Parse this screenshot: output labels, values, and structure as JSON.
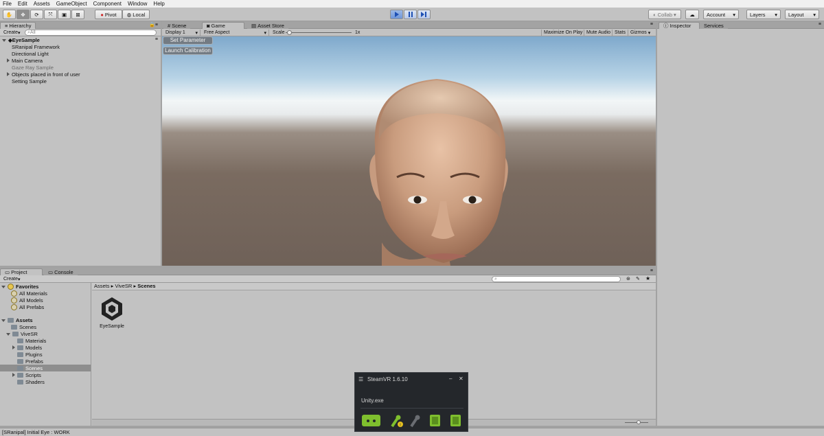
{
  "menubar": [
    "File",
    "Edit",
    "Assets",
    "GameObject",
    "Component",
    "Window",
    "Help"
  ],
  "toolbar": {
    "pivot": "Pivot",
    "local": "Local",
    "collab": "Collab",
    "account": "Account",
    "layers": "Layers",
    "layout": "Layout"
  },
  "hierarchy": {
    "tab": "Hierarchy",
    "create": "Create",
    "search_placeholder": "All",
    "scene": "EyeSample",
    "items": [
      "SRanipal Framework",
      "Directional Light",
      "Main Camera",
      "Gaze Ray Sample",
      "Objects placed in front of user",
      "Setting Sample"
    ]
  },
  "center_tabs": [
    "Scene",
    "Game",
    "Asset Store"
  ],
  "game_bar": {
    "display": "Display 1",
    "aspect": "Free Aspect",
    "scale_label": "Scale",
    "scale_value": "1x",
    "maximize": "Maximize On Play",
    "mute": "Mute Audio",
    "stats": "Stats",
    "gizmos": "Gizmos"
  },
  "game_buttons": {
    "set_parameter": "Set Parameter",
    "launch_calibration": "Launch Calibration"
  },
  "inspector_tabs": [
    "Inspector",
    "Services"
  ],
  "project": {
    "tabs": [
      "Project",
      "Console"
    ],
    "create": "Create",
    "favorites": "Favorites",
    "favorite_items": [
      "All Materials",
      "All Models",
      "All Prefabs"
    ],
    "assets": "Assets",
    "asset_items": [
      "Scenes",
      "ViveSR"
    ],
    "vivesr_items": [
      "Materials",
      "Models",
      "Plugins",
      "Prefabs",
      "Scenes",
      "Scripts",
      "Shaders"
    ],
    "breadcrumb": [
      "Assets",
      "ViveSR",
      "Scenes"
    ],
    "file": "EyeSample"
  },
  "steamvr": {
    "title": "SteamVR 1.6.10",
    "app": "Unity.exe"
  },
  "status": "[SRanipal] Initial Eye : WORK"
}
